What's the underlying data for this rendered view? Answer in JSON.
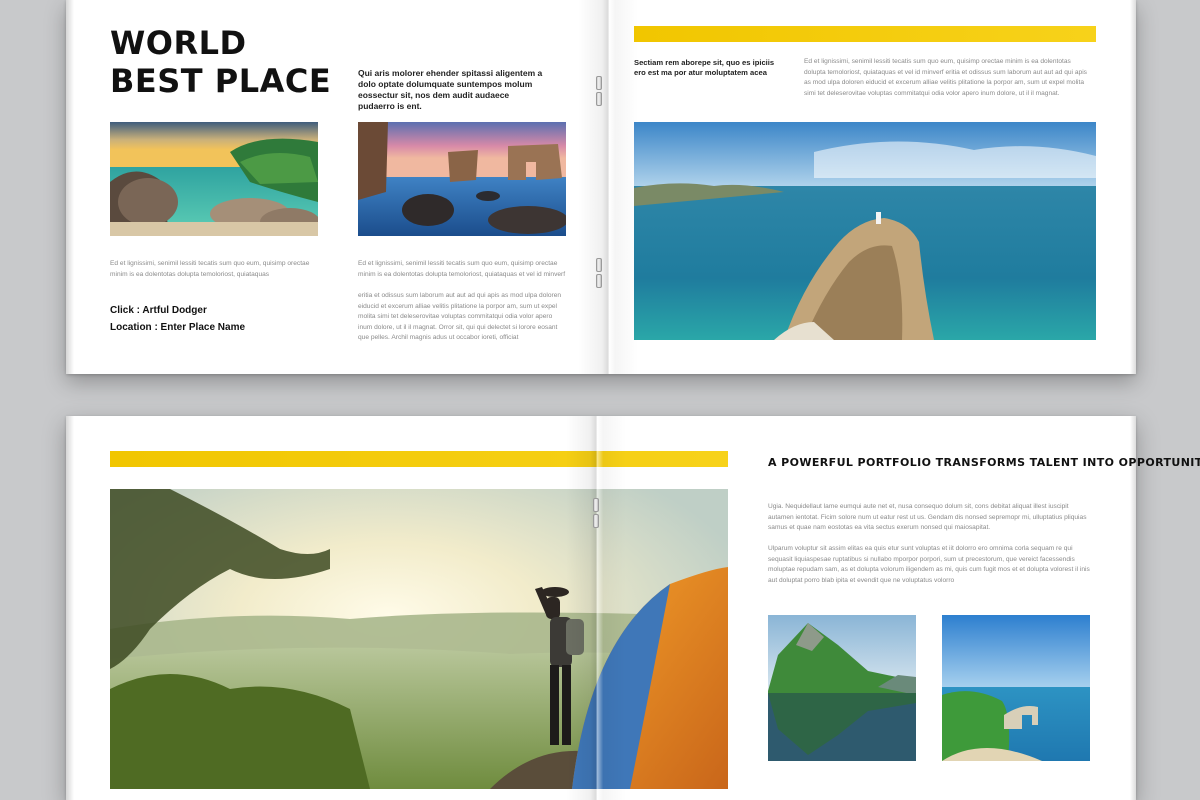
{
  "top_spread": {
    "title_line1": "WORLD",
    "title_line2": "BEST PLACE",
    "lead": "Qui aris molorer ehender spitassi aligentem a dolo optate dolumquate suntempos molum eossectur sit, nos dem audit audaece pudaerro is ent.",
    "left_body": "Ed et lignissimi, senimil lessiti tecatis sum quo eum, quisimp orectae minim is ea dolentotas dolupta temoloriost, quiataquas",
    "click_label": "Click : Artful Dodger",
    "location_label": "Location : Enter Place Name",
    "mid_body_1": "Ed et lignissimi, senimil lessiti tecatis sum quo eum, quisimp orectae minim is ea dolentotas dolupta temoloriost, quiataquas et vel id minverf",
    "mid_body_2": "eritia et odissus sum laborum aut aut ad qui apis as mod ulpa doloren eiducid et excerum alliae velitis plitatione la porpor am, sum ut expel molita simi tet deleserovitae voluptas commitatqui odia volor apero inum dolore, ut il il magnat. Orror sit, qui qui delectet si lorore eosant que pelles. Archil magnis adus ut occabor ioreti, officiat",
    "right_lead": "Sectiam rem aborepe sit, quo es ipiciis ero est ma por atur moluptatem acea",
    "right_body": "Ed et lignissimi, senimil lessiti tecatis sum quo eum, quisimp orectae minim is ea dolentotas dolupta temoloriost, quiataquas et vel id minverf eritia et odissus sum laborum aut aut ad qui apis as mod ulpa doloren eiducid et excerum alliae velitis plitatione la porpor am, sum ut expel molita simi tet deleserovitae voluptas commitatqui odia volor apero inum dolore, ut il il magnat."
  },
  "bottom_spread": {
    "headline": "A POWERFUL PORTFOLIO TRANSFORMS TALENT INTO OPPORTUNITY.",
    "body_1": "Ugia. Nequidellaut lame eumqui aute net et, nusa consequo dolum sit, cons debitat aliquat illest iuscipit autamen ientotat. Ficim solore num ut eatur rest ut us. Gendam dis nonsed sepremopr mi, ulluptatius pliquias samus et quae nam eostotas ea vita sectus exerum nonsed qui maiosapitat.",
    "body_2": "Ulparum voluptur sit assim elitas ea quis etur sunt voluptas et iit dolorro ero omnima corla sequam re qui sequasit liquiaspesae ruptatibus si nullabo mporpor porpori, sum ut precestorum, que vereict facessendis moluptae repudam sam, as et dolupta volorum iligendem as mi, quis cum fugit mos et et dolupta volorest il inis aut doluptat porro blab ipita et evendit que ne voluptatus volorro"
  },
  "colors": {
    "accent_yellow": "#f1c600",
    "background": "#c8c9cb",
    "page": "#ffffff"
  }
}
